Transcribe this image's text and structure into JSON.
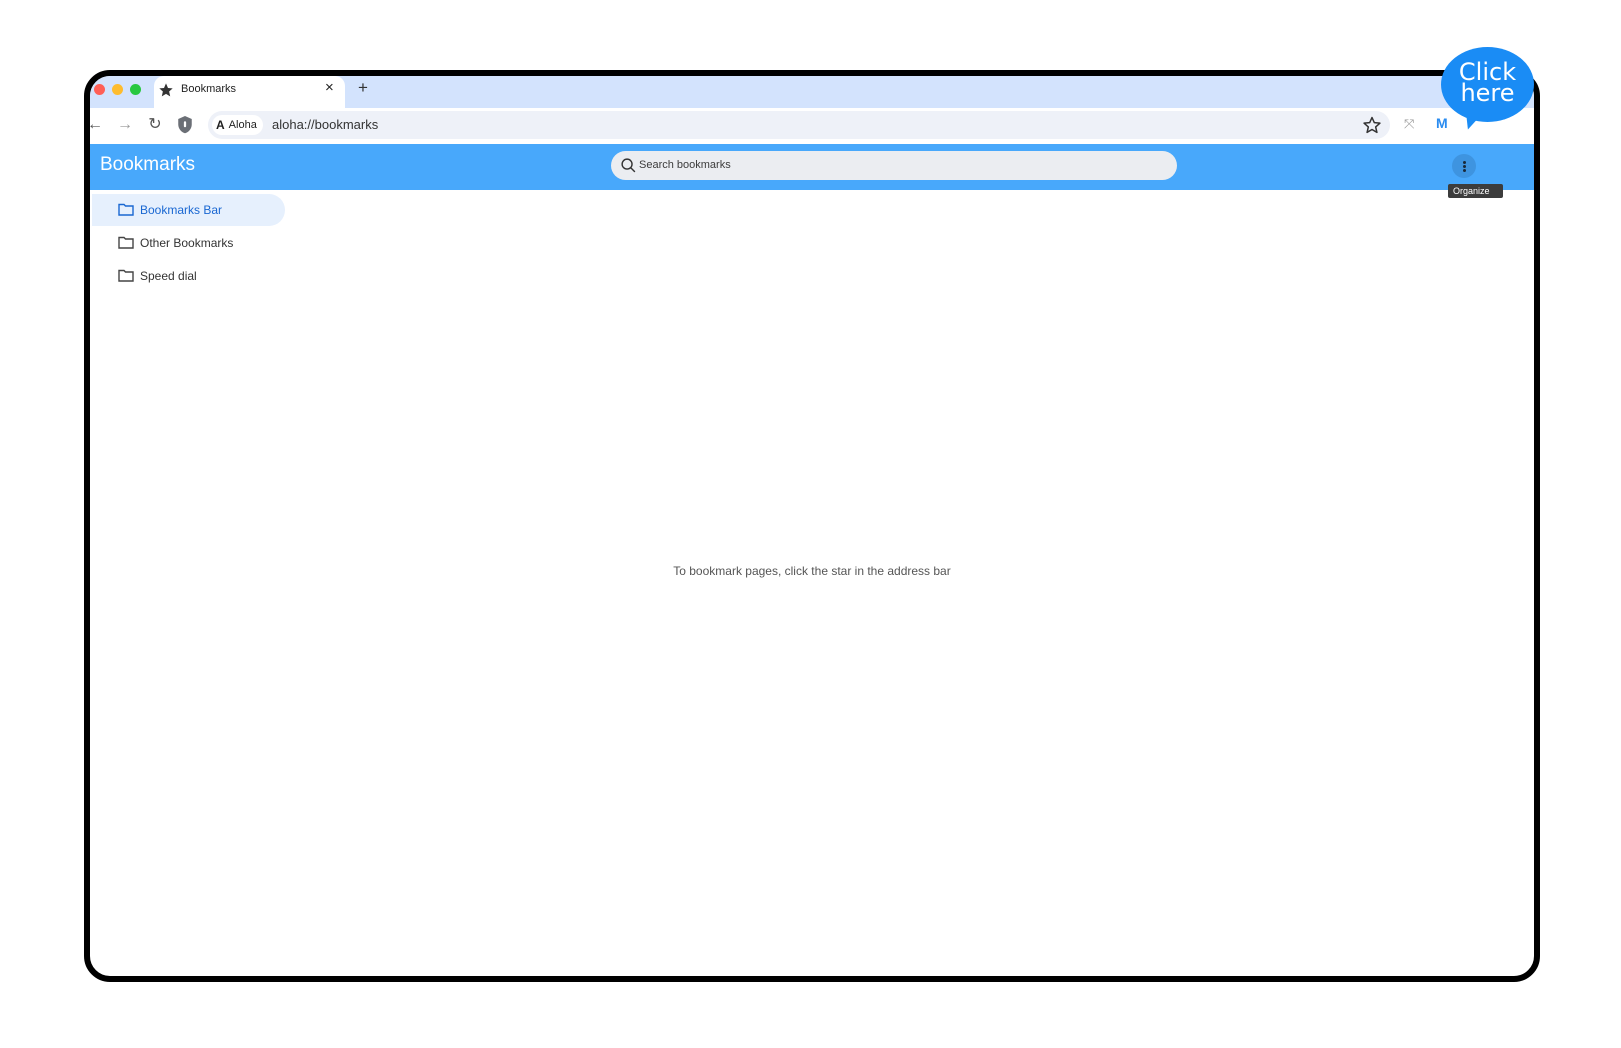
{
  "tab": {
    "title": "Bookmarks",
    "close": "×",
    "new_tab": "+"
  },
  "toolbar": {
    "back": "←",
    "forward": "→",
    "reload": "↻",
    "chip_logo": "A",
    "chip_label": "Aloha",
    "url": "aloha://bookmarks",
    "profile": "M",
    "ext": "⤧"
  },
  "header": {
    "title": "Bookmarks",
    "search_placeholder": "Search bookmarks",
    "menu_tooltip": "Organize"
  },
  "sidebar": {
    "items": [
      {
        "label": "Bookmarks Bar",
        "active": true
      },
      {
        "label": "Other Bookmarks",
        "active": false
      },
      {
        "label": "Speed dial",
        "active": false
      }
    ]
  },
  "main": {
    "empty_message": "To bookmark pages, click the star in the address bar"
  },
  "callout": {
    "line1": "Click",
    "line2": "here"
  },
  "colors": {
    "header": "#48a8fb",
    "tabstrip": "#d3e3fd",
    "callout": "#1a8cf5",
    "active_item": "#e6f0fd"
  }
}
